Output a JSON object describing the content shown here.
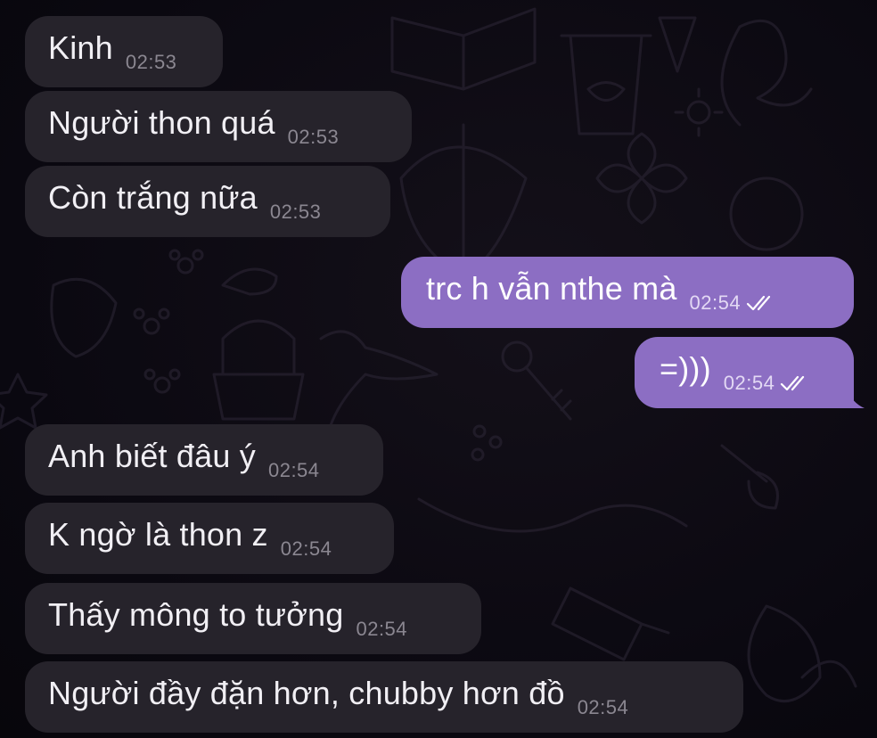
{
  "messages": [
    {
      "direction": "incoming",
      "text": "Kinh",
      "time": "02:53"
    },
    {
      "direction": "incoming",
      "text": "Người thon quá",
      "time": "02:53"
    },
    {
      "direction": "incoming",
      "text": "Còn trắng nữa",
      "time": "02:53"
    },
    {
      "direction": "outgoing",
      "text": "trc h vẫn nthe mà",
      "time": "02:54",
      "status": "read-double-check-icon"
    },
    {
      "direction": "outgoing",
      "text": "=)))",
      "time": "02:54",
      "status": "read-double-check-icon"
    },
    {
      "direction": "incoming",
      "text": "Anh biết đâu ý",
      "time": "02:54"
    },
    {
      "direction": "incoming",
      "text": "K ngờ là thon z",
      "time": "02:54"
    },
    {
      "direction": "incoming",
      "text": "Thấy mông to tưởng",
      "time": "02:54"
    },
    {
      "direction": "incoming",
      "text": "Người đầy đặn hơn, chubby hơn đồ",
      "time": "02:54"
    }
  ],
  "colors": {
    "background": "#0b0910",
    "incoming_bubble": "#26232b",
    "outgoing_bubble": "#8c6ec3",
    "doodle_stroke": "#2a2533"
  }
}
